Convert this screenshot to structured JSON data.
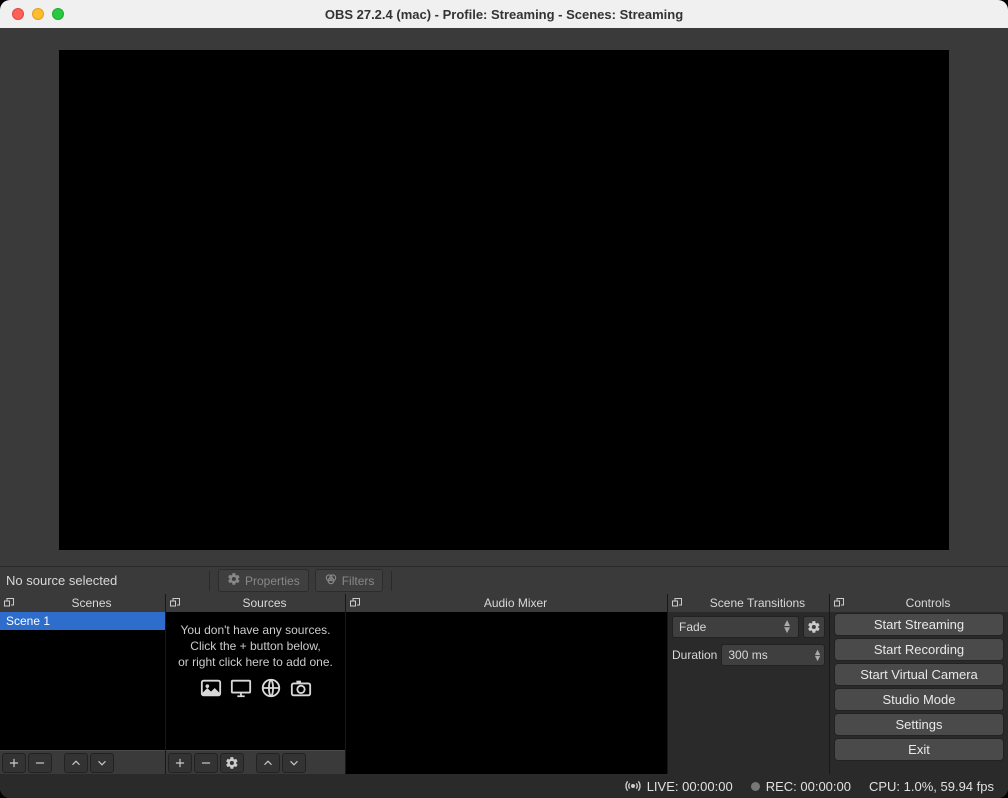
{
  "title": "OBS 27.2.4 (mac) - Profile: Streaming - Scenes: Streaming",
  "sourcebar": {
    "no_source": "No source selected",
    "properties": "Properties",
    "filters": "Filters"
  },
  "docks": {
    "scenes_title": "Scenes",
    "sources_title": "Sources",
    "mixer_title": "Audio Mixer",
    "transitions_title": "Scene Transitions",
    "controls_title": "Controls"
  },
  "scenes": {
    "items": [
      "Scene 1"
    ]
  },
  "sources_empty": {
    "line1": "You don't have any sources.",
    "line2": "Click the + button below,",
    "line3": "or right click here to add one."
  },
  "transitions": {
    "selected": "Fade",
    "duration_label": "Duration",
    "duration_value": "300 ms"
  },
  "controls": {
    "start_streaming": "Start Streaming",
    "start_recording": "Start Recording",
    "start_virtualcam": "Start Virtual Camera",
    "studio_mode": "Studio Mode",
    "settings": "Settings",
    "exit": "Exit"
  },
  "status": {
    "live": "LIVE: 00:00:00",
    "rec": "REC: 00:00:00",
    "cpu": "CPU: 1.0%, 59.94 fps"
  }
}
